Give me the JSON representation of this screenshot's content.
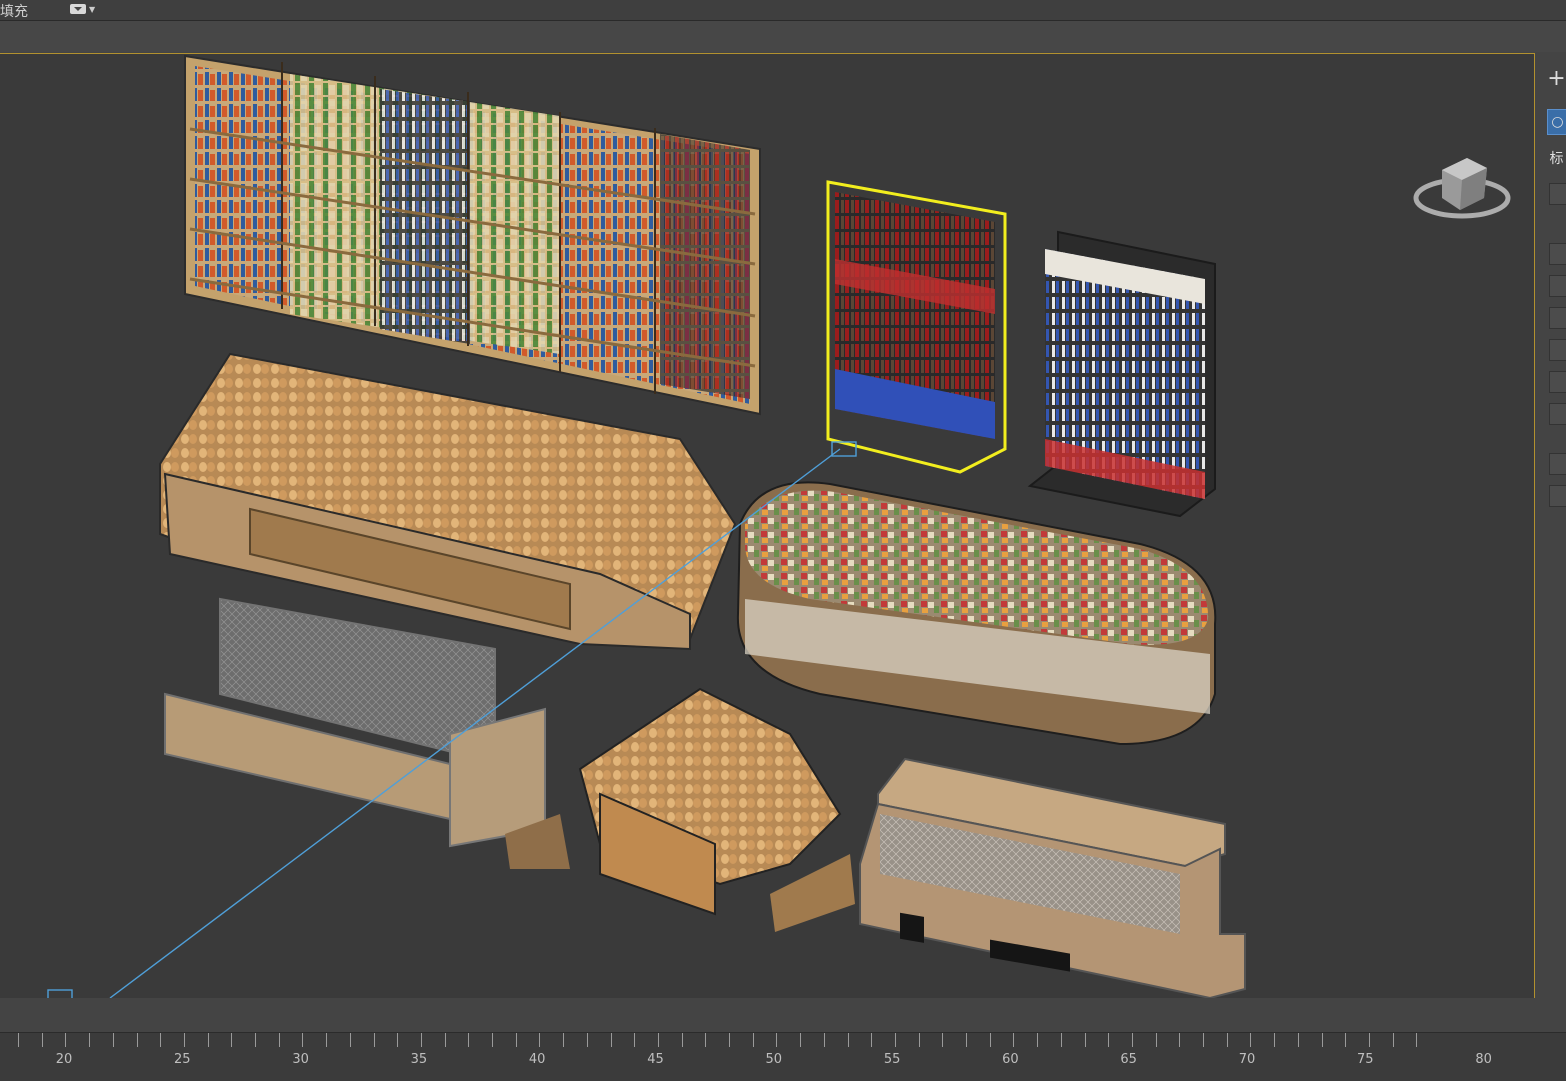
{
  "toolbar": {
    "fill_label": "填充",
    "dropdown_icon": "speech-bubble-dropdown-icon"
  },
  "right_panel": {
    "create_icon": "plus-icon",
    "geometry_icon": "sphere-icon",
    "tab_text": "标"
  },
  "timeline": {
    "labels": [
      "20",
      "25",
      "30",
      "35",
      "40",
      "45",
      "50",
      "55",
      "60",
      "65",
      "70",
      "75",
      "80"
    ]
  },
  "viewport": {
    "selection_color": "#f2ee1e",
    "border_color": "#b2912f",
    "camera_line_color": "#4f9fd8"
  }
}
